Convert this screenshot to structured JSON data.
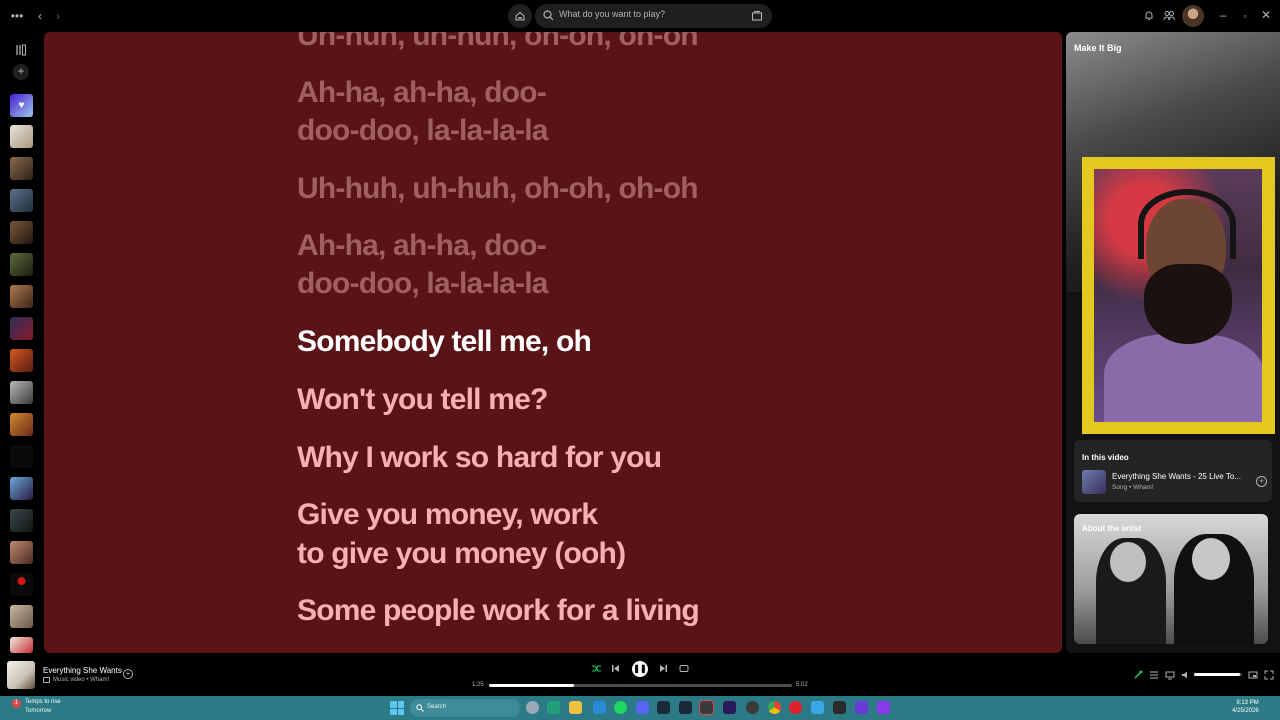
{
  "topbar": {
    "search_placeholder": "What do you want to play?"
  },
  "main": {
    "lyrics": [
      {
        "text": "Uh-huh, uh-huh, oh-oh, oh-oh",
        "state": "past"
      },
      {
        "text": "Ah-ha, ah-ha, doo-",
        "state": "past"
      },
      {
        "text": "doo-doo, la-la-la-la",
        "state": "past"
      },
      {
        "text": "Uh-huh, uh-huh, oh-oh, oh-oh",
        "state": "past"
      },
      {
        "text": "Ah-ha, ah-ha, doo-",
        "state": "past"
      },
      {
        "text": "doo-doo, la-la-la-la",
        "state": "past"
      },
      {
        "text": "Somebody tell me, oh",
        "state": "current"
      },
      {
        "text": "Won't you tell me?",
        "state": "future"
      },
      {
        "text": "Why I work so hard for you",
        "state": "future"
      },
      {
        "text": "Give you money, work",
        "state": "future"
      },
      {
        "text": "to give you money (ooh)",
        "state": "future"
      },
      {
        "text": "Some people work for a living",
        "state": "future"
      }
    ],
    "background_color": "#5a1317"
  },
  "right_panel": {
    "title": "Make It Big",
    "in_this_video": {
      "header": "In this video",
      "track_title": "Everything She Wants - 25 Live To...",
      "track_meta": "Song • Wham!"
    },
    "about_artist_label": "About the artist"
  },
  "now_playing": {
    "title": "Everything She Wants",
    "subtitle": "Music video • Wham!",
    "elapsed": "1:25",
    "duration": "5:02",
    "progress_fraction": 0.282,
    "volume_fraction": 0.95
  },
  "taskbar": {
    "weather_badge": "1",
    "weather_line1": "Temps to rise",
    "weather_line2": "Tomorrow",
    "search_placeholder": "Search",
    "time": "9:13 PM",
    "date": "4/25/2026"
  },
  "colors": {
    "accent_green": "#1ed760",
    "lyrics_past": "#a0605f",
    "lyrics_current": "#ffffff",
    "lyrics_future": "#f6b2b3",
    "webcam_border": "#e4c81f"
  }
}
